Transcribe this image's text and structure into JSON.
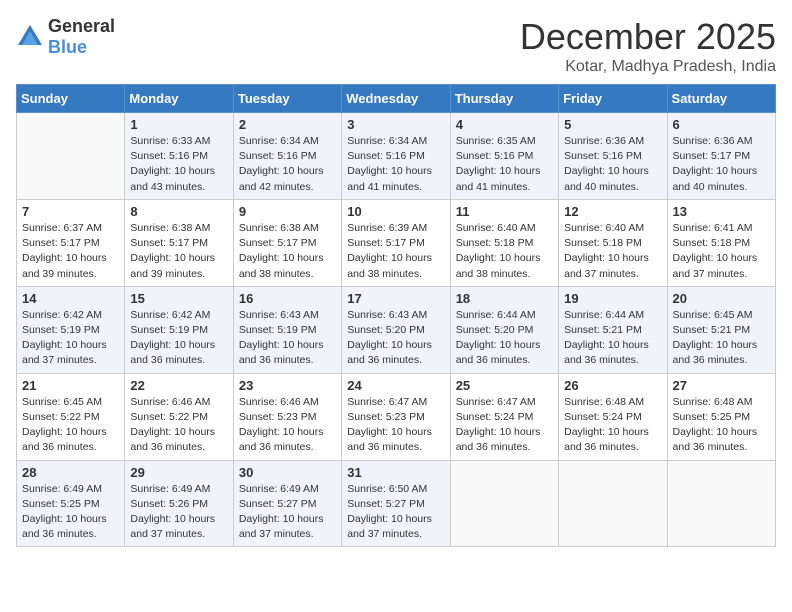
{
  "logo": {
    "general": "General",
    "blue": "Blue"
  },
  "title": "December 2025",
  "location": "Kotar, Madhya Pradesh, India",
  "days_of_week": [
    "Sunday",
    "Monday",
    "Tuesday",
    "Wednesday",
    "Thursday",
    "Friday",
    "Saturday"
  ],
  "weeks": [
    [
      {
        "day": "",
        "info": ""
      },
      {
        "day": "1",
        "info": "Sunrise: 6:33 AM\nSunset: 5:16 PM\nDaylight: 10 hours\nand 43 minutes."
      },
      {
        "day": "2",
        "info": "Sunrise: 6:34 AM\nSunset: 5:16 PM\nDaylight: 10 hours\nand 42 minutes."
      },
      {
        "day": "3",
        "info": "Sunrise: 6:34 AM\nSunset: 5:16 PM\nDaylight: 10 hours\nand 41 minutes."
      },
      {
        "day": "4",
        "info": "Sunrise: 6:35 AM\nSunset: 5:16 PM\nDaylight: 10 hours\nand 41 minutes."
      },
      {
        "day": "5",
        "info": "Sunrise: 6:36 AM\nSunset: 5:16 PM\nDaylight: 10 hours\nand 40 minutes."
      },
      {
        "day": "6",
        "info": "Sunrise: 6:36 AM\nSunset: 5:17 PM\nDaylight: 10 hours\nand 40 minutes."
      }
    ],
    [
      {
        "day": "7",
        "info": "Sunrise: 6:37 AM\nSunset: 5:17 PM\nDaylight: 10 hours\nand 39 minutes."
      },
      {
        "day": "8",
        "info": "Sunrise: 6:38 AM\nSunset: 5:17 PM\nDaylight: 10 hours\nand 39 minutes."
      },
      {
        "day": "9",
        "info": "Sunrise: 6:38 AM\nSunset: 5:17 PM\nDaylight: 10 hours\nand 38 minutes."
      },
      {
        "day": "10",
        "info": "Sunrise: 6:39 AM\nSunset: 5:17 PM\nDaylight: 10 hours\nand 38 minutes."
      },
      {
        "day": "11",
        "info": "Sunrise: 6:40 AM\nSunset: 5:18 PM\nDaylight: 10 hours\nand 38 minutes."
      },
      {
        "day": "12",
        "info": "Sunrise: 6:40 AM\nSunset: 5:18 PM\nDaylight: 10 hours\nand 37 minutes."
      },
      {
        "day": "13",
        "info": "Sunrise: 6:41 AM\nSunset: 5:18 PM\nDaylight: 10 hours\nand 37 minutes."
      }
    ],
    [
      {
        "day": "14",
        "info": "Sunrise: 6:42 AM\nSunset: 5:19 PM\nDaylight: 10 hours\nand 37 minutes."
      },
      {
        "day": "15",
        "info": "Sunrise: 6:42 AM\nSunset: 5:19 PM\nDaylight: 10 hours\nand 36 minutes."
      },
      {
        "day": "16",
        "info": "Sunrise: 6:43 AM\nSunset: 5:19 PM\nDaylight: 10 hours\nand 36 minutes."
      },
      {
        "day": "17",
        "info": "Sunrise: 6:43 AM\nSunset: 5:20 PM\nDaylight: 10 hours\nand 36 minutes."
      },
      {
        "day": "18",
        "info": "Sunrise: 6:44 AM\nSunset: 5:20 PM\nDaylight: 10 hours\nand 36 minutes."
      },
      {
        "day": "19",
        "info": "Sunrise: 6:44 AM\nSunset: 5:21 PM\nDaylight: 10 hours\nand 36 minutes."
      },
      {
        "day": "20",
        "info": "Sunrise: 6:45 AM\nSunset: 5:21 PM\nDaylight: 10 hours\nand 36 minutes."
      }
    ],
    [
      {
        "day": "21",
        "info": "Sunrise: 6:45 AM\nSunset: 5:22 PM\nDaylight: 10 hours\nand 36 minutes."
      },
      {
        "day": "22",
        "info": "Sunrise: 6:46 AM\nSunset: 5:22 PM\nDaylight: 10 hours\nand 36 minutes."
      },
      {
        "day": "23",
        "info": "Sunrise: 6:46 AM\nSunset: 5:23 PM\nDaylight: 10 hours\nand 36 minutes."
      },
      {
        "day": "24",
        "info": "Sunrise: 6:47 AM\nSunset: 5:23 PM\nDaylight: 10 hours\nand 36 minutes."
      },
      {
        "day": "25",
        "info": "Sunrise: 6:47 AM\nSunset: 5:24 PM\nDaylight: 10 hours\nand 36 minutes."
      },
      {
        "day": "26",
        "info": "Sunrise: 6:48 AM\nSunset: 5:24 PM\nDaylight: 10 hours\nand 36 minutes."
      },
      {
        "day": "27",
        "info": "Sunrise: 6:48 AM\nSunset: 5:25 PM\nDaylight: 10 hours\nand 36 minutes."
      }
    ],
    [
      {
        "day": "28",
        "info": "Sunrise: 6:49 AM\nSunset: 5:25 PM\nDaylight: 10 hours\nand 36 minutes."
      },
      {
        "day": "29",
        "info": "Sunrise: 6:49 AM\nSunset: 5:26 PM\nDaylight: 10 hours\nand 37 minutes."
      },
      {
        "day": "30",
        "info": "Sunrise: 6:49 AM\nSunset: 5:27 PM\nDaylight: 10 hours\nand 37 minutes."
      },
      {
        "day": "31",
        "info": "Sunrise: 6:50 AM\nSunset: 5:27 PM\nDaylight: 10 hours\nand 37 minutes."
      },
      {
        "day": "",
        "info": ""
      },
      {
        "day": "",
        "info": ""
      },
      {
        "day": "",
        "info": ""
      }
    ]
  ]
}
